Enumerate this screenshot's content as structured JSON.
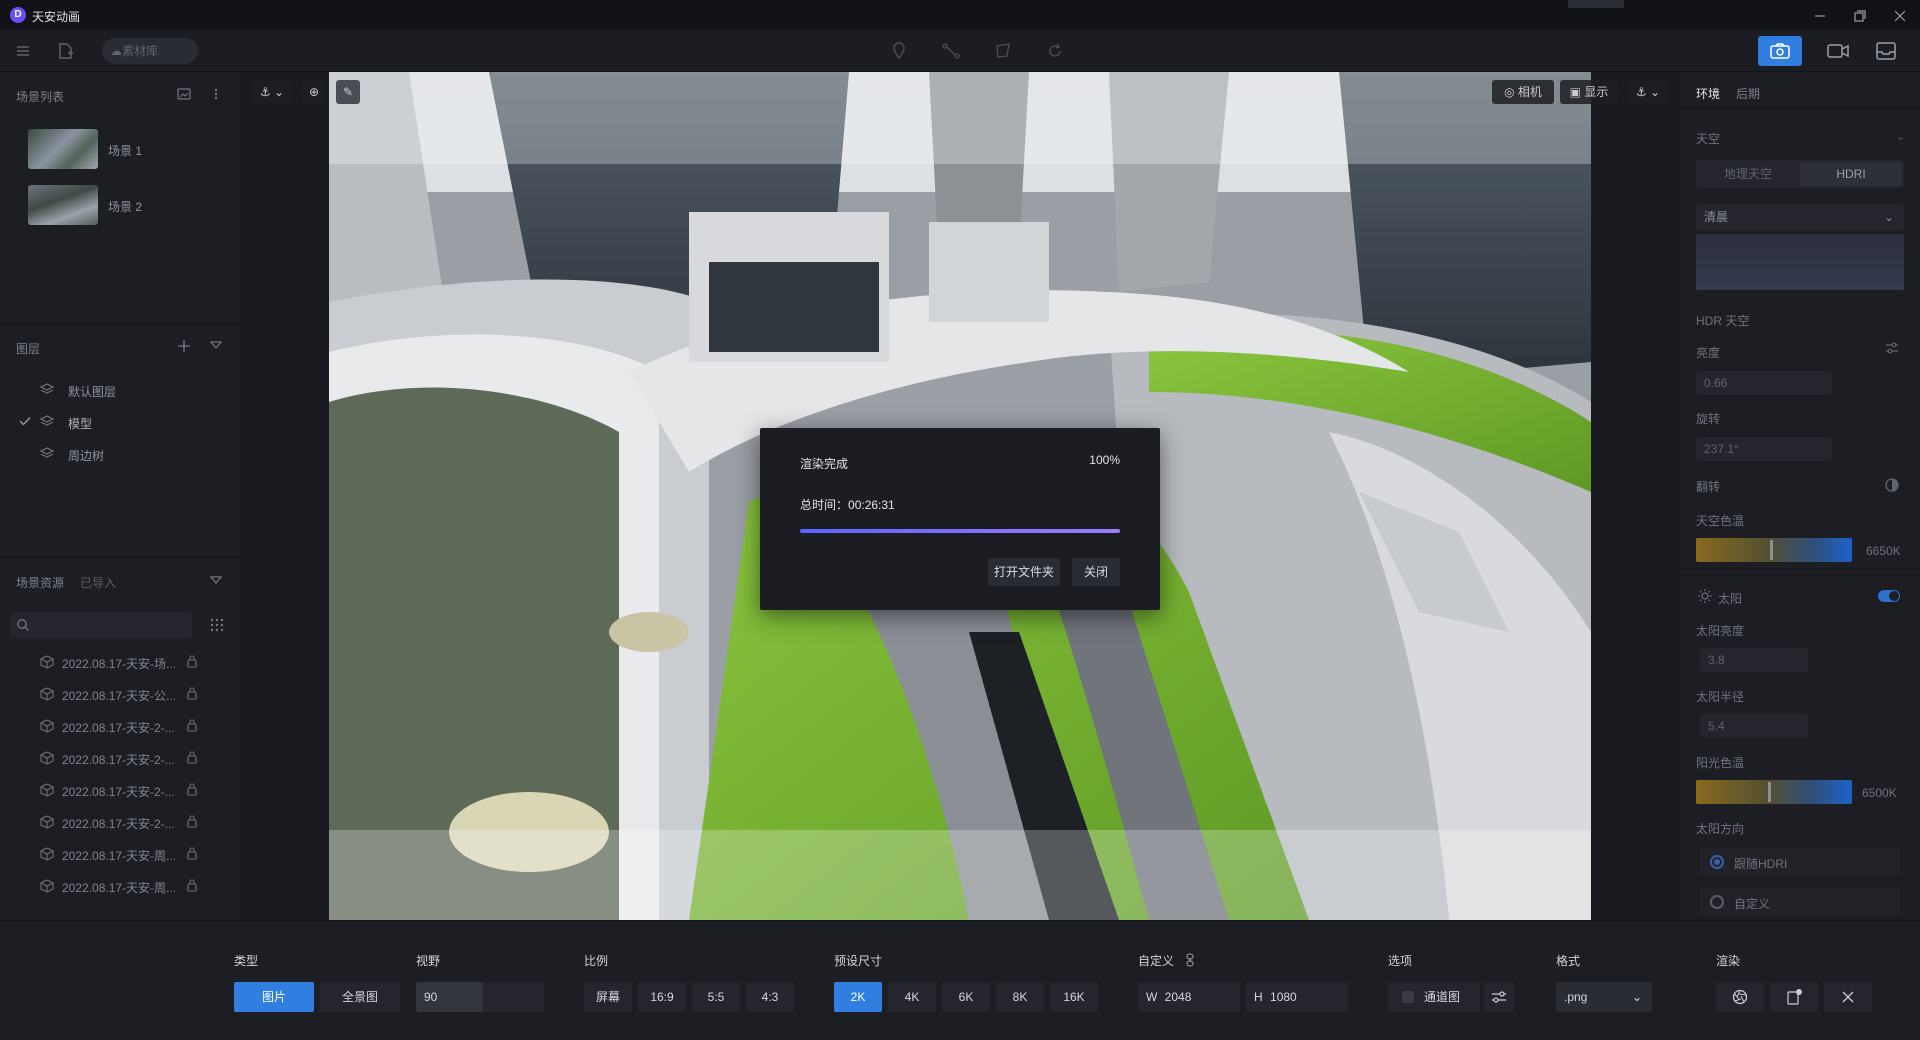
{
  "app": {
    "title": "天安动画"
  },
  "toolbar": {
    "assets_label": "素材库"
  },
  "left": {
    "scene_list_title": "场景列表",
    "scenes": [
      {
        "label": "场景 1"
      },
      {
        "label": "场景 2"
      }
    ],
    "layers_title": "图层",
    "layers": [
      {
        "label": "默认图层",
        "checked": false
      },
      {
        "label": "模型",
        "checked": true
      },
      {
        "label": "周边树",
        "checked": false
      }
    ],
    "resources_title": "场景资源",
    "resources_tab_imported": "已导入",
    "resources": [
      {
        "label": "2022.08.17-天安-场..."
      },
      {
        "label": "2022.08.17-天安-公..."
      },
      {
        "label": "2022.08.17-天安-2-..."
      },
      {
        "label": "2022.08.17-天安-2-..."
      },
      {
        "label": "2022.08.17-天安-2-..."
      },
      {
        "label": "2022.08.17-天安-2-..."
      },
      {
        "label": "2022.08.17-天安-周..."
      },
      {
        "label": "2022.08.17-天安-周..."
      }
    ]
  },
  "viewport": {
    "camera_label": "相机",
    "display_label": "显示"
  },
  "dialog": {
    "title": "渲染完成",
    "percent_text": "100%",
    "progress": 1.0,
    "time_label": "总时间：",
    "time_value": "00:26:31",
    "open_folder": "打开文件夹",
    "close": "关闭"
  },
  "right": {
    "tabs": {
      "env": "环境",
      "post": "后期"
    },
    "sky_title": "天空",
    "sky_modes": {
      "geo": "地理天空",
      "hdri": "HDRI"
    },
    "sky_select": "清晨",
    "hdr_sky": "HDR 天空",
    "brightness_label": "亮度",
    "brightness_value": "0.66",
    "rotation_label": "旋转",
    "rotation_value": "237.1°",
    "flip_label": "翻转",
    "sky_color_temp_label": "天空色温",
    "sky_color_temp_value": "6650K",
    "sun_label": "太阳",
    "sun_brightness_label": "太阳亮度",
    "sun_brightness_value": "3.8",
    "sun_radius_label": "太阳半径",
    "sun_radius_value": "5.4",
    "sunlight_temp_label": "阳光色温",
    "sunlight_temp_value": "6500K",
    "sun_direction_label": "太阳方向",
    "follow_hdri": "跟随HDRI",
    "custom": "自定义"
  },
  "bottom": {
    "type_title": "类型",
    "type_image": "图片",
    "type_panorama": "全景图",
    "fov_title": "视野",
    "fov_value": "90",
    "ratio_title": "比例",
    "ratios": [
      "屏幕",
      "16:9",
      "5:5",
      "4:3"
    ],
    "preset_title": "预设尺寸",
    "presets": [
      "2K",
      "4K",
      "6K",
      "8K",
      "16K"
    ],
    "custom_title": "自定义",
    "width_label": "W",
    "width_value": "2048",
    "height_label": "H",
    "height_value": "1080",
    "options_title": "选项",
    "channel_map": "通道图",
    "format_title": "格式",
    "format_value": ".png",
    "render_title": "渲染"
  }
}
